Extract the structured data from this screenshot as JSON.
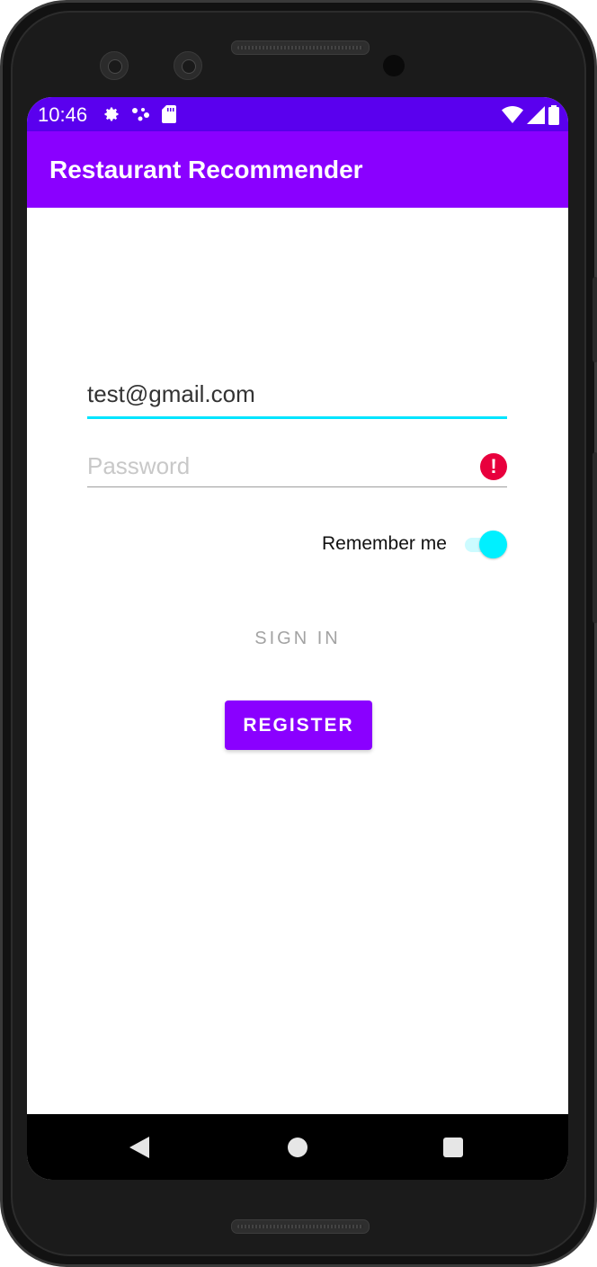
{
  "status_bar": {
    "time": "10:46",
    "icons_left": [
      "settings-icon",
      "connection-dots-icon",
      "sd-card-icon"
    ],
    "icons_right": [
      "wifi-icon",
      "signal-icon",
      "battery-icon"
    ]
  },
  "app_bar": {
    "title": "Restaurant Recommender"
  },
  "form": {
    "email_value": "test@gmail.com",
    "password_placeholder": "Password",
    "password_error_icon": "error-icon",
    "error_glyph": "!",
    "remember_label": "Remember me",
    "remember_checked": true,
    "sign_in_label": "SIGN IN",
    "register_label": "REGISTER"
  },
  "colors": {
    "status_bar": "#5a00ee",
    "app_bar": "#8a00ff",
    "accent": "#00e5ff",
    "error": "#e8003d",
    "primary_button": "#8a00ff"
  },
  "nav_bar": {
    "items": [
      "back-icon",
      "home-icon",
      "recents-icon"
    ]
  }
}
